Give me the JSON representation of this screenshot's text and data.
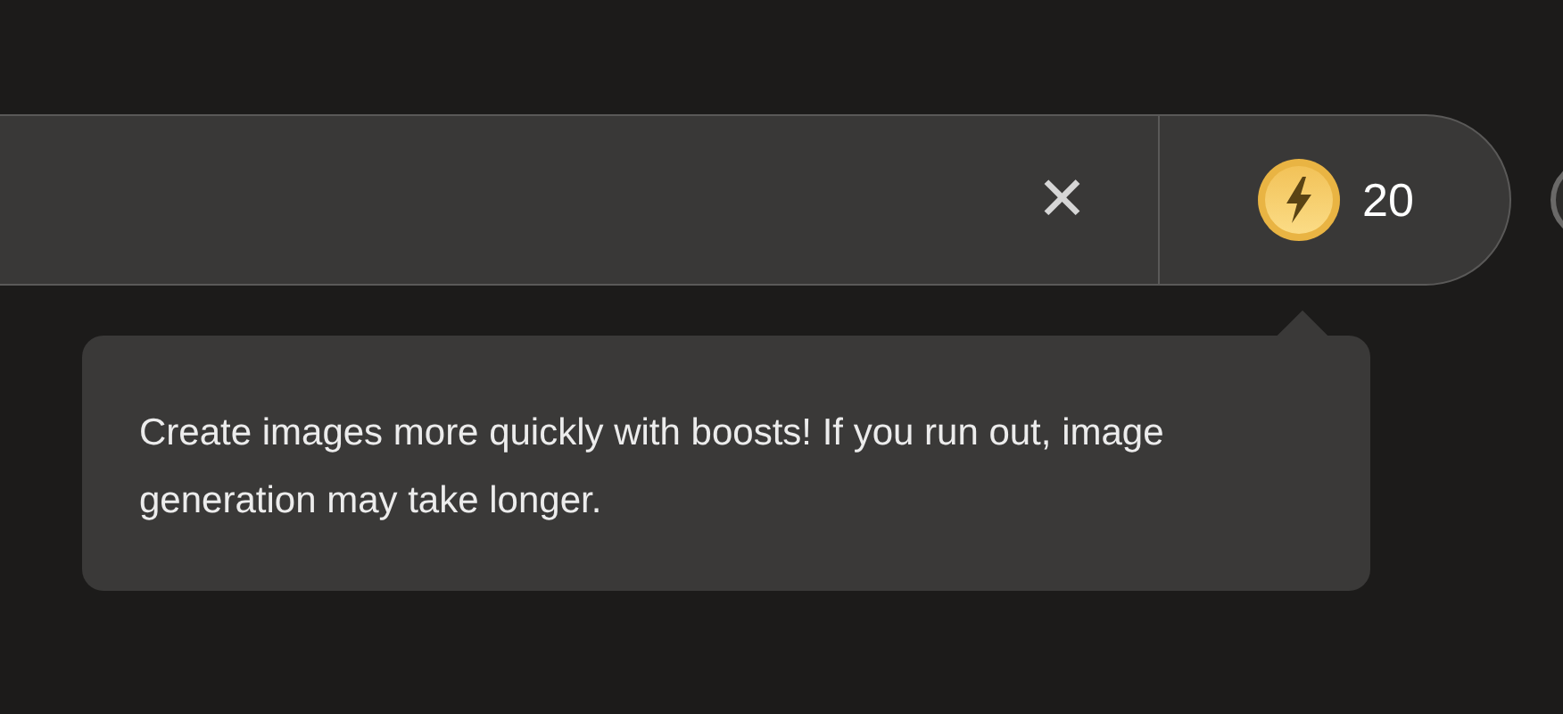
{
  "search_bar": {
    "clear_button": "✕",
    "boosts": {
      "count": "20"
    }
  },
  "tooltip": {
    "text": "Create images more quickly with boosts! If you run out, image generation may take longer."
  }
}
